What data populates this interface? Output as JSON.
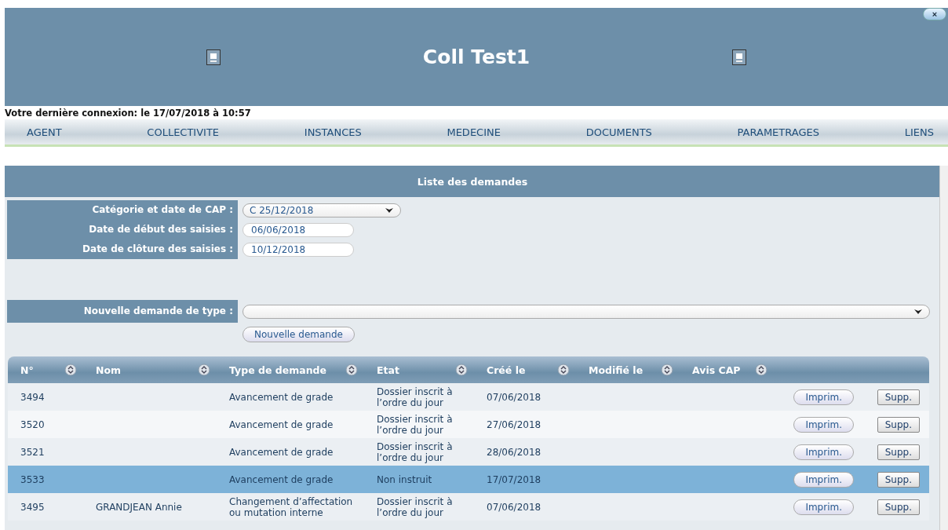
{
  "header": {
    "title": "Coll Test1",
    "close_label": "×"
  },
  "last_login": "Votre dernière connexion: le 17/07/2018 à 10:57",
  "nav": [
    {
      "label": "AGENT"
    },
    {
      "label": "COLLECTIVITE"
    },
    {
      "label": "INSTANCES"
    },
    {
      "label": "MEDECINE"
    },
    {
      "label": "DOCUMENTS"
    },
    {
      "label": "PARAMETRAGES"
    },
    {
      "label": "LIENS"
    }
  ],
  "panel": {
    "title": "Liste des demandes",
    "fields": [
      {
        "kind": "select",
        "label": "Catégorie et date de CAP :",
        "value": "C  25/12/2018"
      },
      {
        "kind": "text",
        "label": "Date de début des saisies :",
        "value": "06/06/2018"
      },
      {
        "kind": "text",
        "label": "Date de clôture des saisies :",
        "value": "10/12/2018"
      }
    ],
    "new_request": {
      "label": "Nouvelle demande de type :",
      "button": "Nouvelle demande"
    }
  },
  "table": {
    "columns": [
      "N°",
      "Nom",
      "Type de demande",
      "Etat",
      "Créé le",
      "Modifié le",
      "Avis CAP"
    ],
    "rows": [
      {
        "number": "3494",
        "name": "",
        "type": "Avancement de grade",
        "state": "Dossier inscrit à l’ordre du jour",
        "created": "07/06/2018",
        "selected": false,
        "print": "Imprim.",
        "delete": "Supp."
      },
      {
        "number": "3520",
        "name": "",
        "type": "Avancement de grade",
        "state": "Dossier inscrit à l’ordre du jour",
        "created": "27/06/2018",
        "selected": false,
        "print": "Imprim.",
        "delete": "Supp."
      },
      {
        "number": "3521",
        "name": "",
        "type": "Avancement de grade",
        "state": "Dossier inscrit à l’ordre du jour",
        "created": "28/06/2018",
        "selected": false,
        "print": "Imprim.",
        "delete": "Supp."
      },
      {
        "number": "3533",
        "name": "",
        "type": "Avancement de grade",
        "state": "Non instruit",
        "created": "17/07/2018",
        "selected": true,
        "print": "Imprim.",
        "delete": "Supp."
      },
      {
        "number": "3495",
        "name": "GRANDJEAN Annie",
        "type": "Changement d’affectation ou mutation interne",
        "state": "Dossier inscrit à l’ordre du jour",
        "created": "07/06/2018",
        "selected": false,
        "print": "Imprim.",
        "delete": "Supp."
      }
    ]
  }
}
